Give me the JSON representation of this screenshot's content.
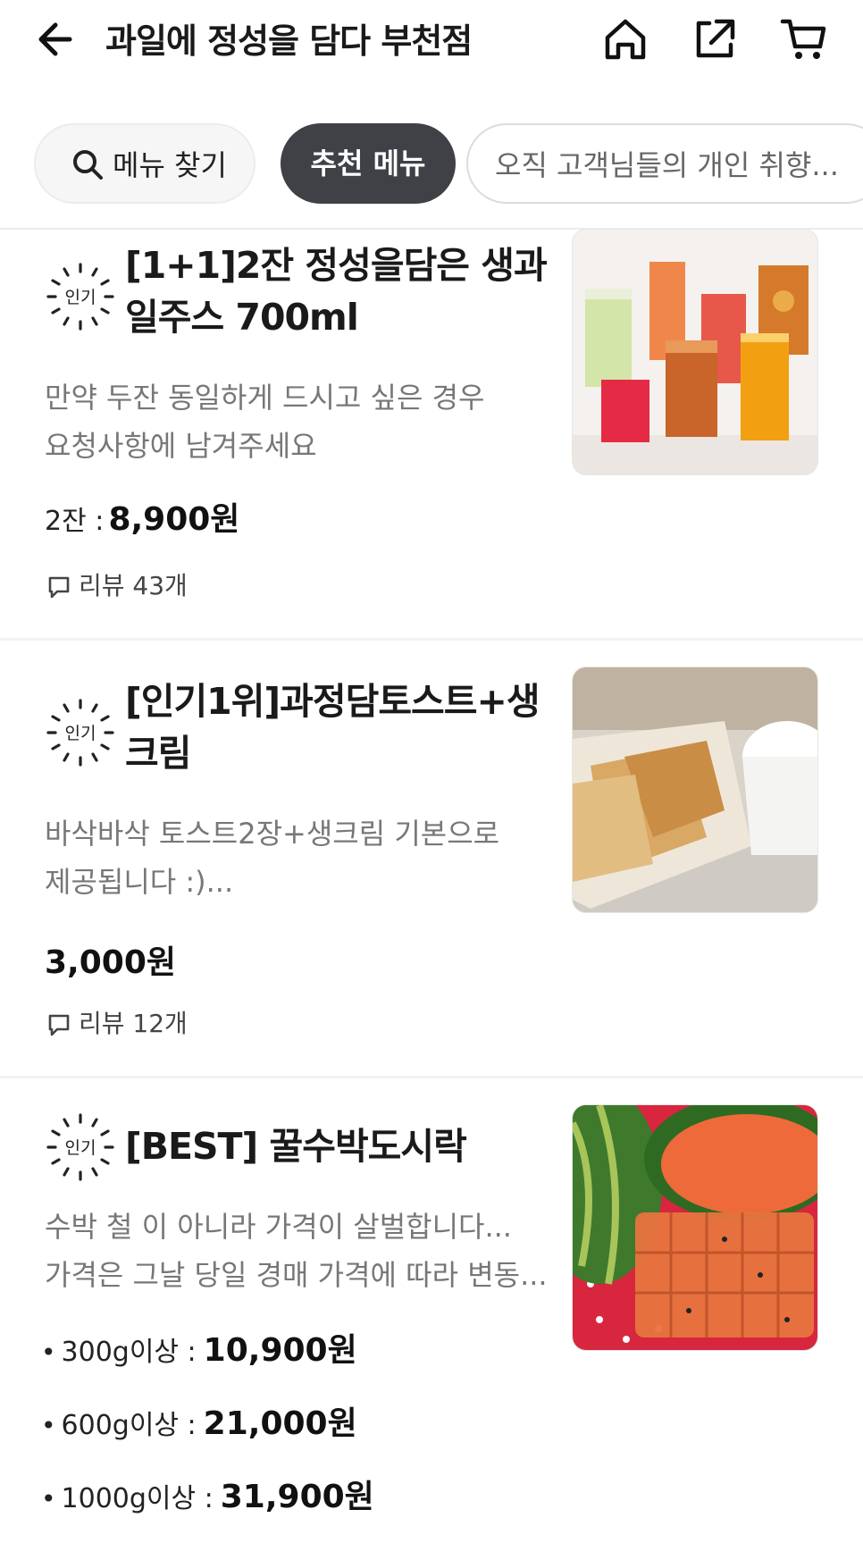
{
  "header": {
    "title": "과일에 정성을 담다 부천점",
    "icons": [
      "arrow-left-icon",
      "home-icon",
      "share-icon",
      "cart-icon"
    ]
  },
  "chips": {
    "search_label": "메뉴 찾기",
    "recommended_label": "추천 메뉴",
    "description_label": "오직 고객님들의 개인 취향..."
  },
  "badge_text": "인기",
  "items": [
    {
      "name": "[1+1]2잔 정성을담은 생과일주스 700ml",
      "description": [
        "만약 두잔 동일하게 드시고 싶은 경우",
        "요청사항에 남겨주세요"
      ],
      "price_label": "2잔 :",
      "price": "8,900원",
      "review": "리뷰 43개"
    },
    {
      "name": "[인기1위]과정담토스트+생크림",
      "description": [
        "바삭바삭 토스트2장+생크림 기본으로",
        "제공됩니다 :)..."
      ],
      "price": "3,000원",
      "review": "리뷰 12개"
    },
    {
      "name": "[BEST] 꿀수박도시락",
      "description": [
        "수박 철 이 아니라 가격이 살벌합니다...",
        "가격은 그날 당일 경매 가격에 따라 변동..."
      ],
      "options": [
        {
          "label": "300g이상 :",
          "price": "10,900원"
        },
        {
          "label": "600g이상 :",
          "price": "21,000원"
        },
        {
          "label": "1000g이상 :",
          "price": "31,900원"
        }
      ]
    }
  ],
  "colors": {
    "accent_dark": "#3f4146",
    "chip_bg": "#f6f6f6",
    "muted_text": "#777777"
  }
}
